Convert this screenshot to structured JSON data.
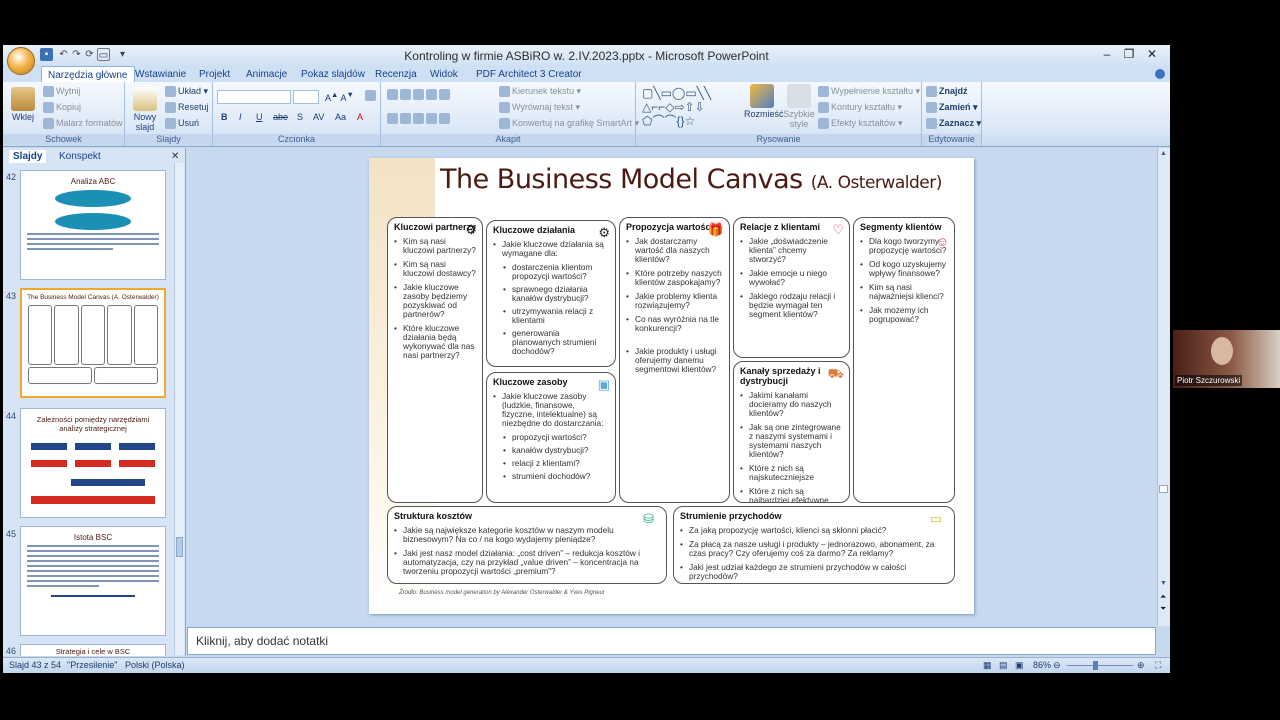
{
  "window": {
    "title": "Kontroling w firmie ASBiRO w. 2.IV.2023.pptx - Microsoft PowerPoint"
  },
  "ribbon_tabs": [
    "Narzędzia główne",
    "Wstawianie",
    "Projekt",
    "Animacje",
    "Pokaz slajdów",
    "Recenzja",
    "Widok",
    "PDF Architect 3 Creator"
  ],
  "ribbon": {
    "schowek": {
      "paste": "Wklej",
      "cut": "Wytnij",
      "copy": "Kopiuj",
      "painter": "Malarz formatów",
      "label": "Schowek"
    },
    "slajdy": {
      "new": "Nowy slajd",
      "layout": "Układ",
      "reset": "Resetuj",
      "delete": "Usuń",
      "label": "Slajdy"
    },
    "czcionka": {
      "label": "Czcionka"
    },
    "akapit": {
      "dir": "Kierunek tekstu",
      "align": "Wyrównaj tekst",
      "smartart": "Konwertuj na grafikę SmartArt",
      "label": "Akapit"
    },
    "rysowanie": {
      "arrange": "Rozmieść",
      "styles": "Szybkie style",
      "fill": "Wypełnienie kształtu",
      "outline": "Kontury kształtu",
      "effects": "Efekty kształtów",
      "label": "Rysowanie"
    },
    "edytowanie": {
      "find": "Znajdź",
      "replace": "Zamień",
      "select": "Zaznacz",
      "label": "Edytowanie"
    }
  },
  "pane": {
    "tabs": [
      "Slajdy",
      "Konspekt"
    ],
    "thumbs": [
      {
        "num": "42",
        "title": "Analiza ABC"
      },
      {
        "num": "43",
        "title": "The Business Model Canvas (A. Osterwalder)"
      },
      {
        "num": "44",
        "title": "Zależności pomiędzy narzędziami analizy strategicznej"
      },
      {
        "num": "45",
        "title": "Istota BSC"
      },
      {
        "num": "46",
        "title": "Strategia i cele w BSC"
      }
    ]
  },
  "slide": {
    "title": "The Business Model Canvas",
    "title_suffix": "(A. Osterwalder)",
    "boxes": {
      "partnerzy": {
        "h": "Kluczowi partnerzy",
        "q": [
          "Kim są nasi kluczowi partnerzy?",
          "Kim są nasi kluczowi dostawcy?",
          "Jakie kluczowe zasoby będziemy pozyskiwać od partnerów?",
          "Które kluczowe działania będą wykonywać dla nas nasi partnerzy?"
        ]
      },
      "dzialania": {
        "h": "Kluczowe działania",
        "q": "Jakie kluczowe działania są wymagane dla:",
        "s": [
          "dostarczenia klientom propozycji wartości?",
          "sprawnego działania kanałów dystrybucji?",
          "utrzymywania relacji z klientami",
          "generowania planowanych strumieni dochodów?"
        ]
      },
      "zasoby": {
        "h": "Kluczowe zasoby",
        "q": "Jakie kluczowe zasoby (ludzkie, finansowe, fizyczne, intelektualne) są niezbędne do dostarczania:",
        "s": [
          "propozycji wartości?",
          "kanałów dystrybucji?",
          "relacji z klientami?",
          "strumieni dochodów?"
        ]
      },
      "propozycja": {
        "h": "Propozycja wartości",
        "q": [
          "Jak dostarczamy wartość dla naszych klientów?",
          "Które potrzeby naszych klientów zaspokajamy?",
          "Jakie problemy klienta rozwiązujemy?",
          "Co nas wyróżnia na tle konkurencji?",
          "Jakie produkty i usługi oferujemy danemu segmentowi klientów?"
        ]
      },
      "relacje": {
        "h": "Relacje z klientami",
        "q": [
          "Jakie „doświadczenie klienta” chcemy stworzyć?",
          "Jakie emocje u niego wywołać?",
          "Jakiego rodzaju relacji i będzie wymagał ten segment klientów?"
        ]
      },
      "kanaly": {
        "h": "Kanały sprzedaży i dystrybucji",
        "q": [
          "Jakimi kanałami docieramy do naszych klientów?",
          "Jak są one zintegrowane z naszymi systemami i systemami naszych klientów?",
          "Które z nich są najskuteczniejsze",
          "Które z nich są najbardziej efektywne kosztowo?"
        ]
      },
      "segmenty": {
        "h": "Segmenty klientów",
        "q": [
          "Dla kogo tworzymy propozycję wartości?",
          "Od kogo uzyskujemy wpływy finansowe?",
          "Kim są nasi najważniejsi klienci?",
          "Jak możemy ich pogrupować?"
        ]
      },
      "koszty": {
        "h": "Struktura kosztów",
        "q": [
          "Jakie są największe kategorie kosztów w naszym modelu biznesowym? Na co / na kogo wydajemy pieniądze?",
          "Jaki jest nasz model działania: „cost driven” – redukcja kosztów i automatyzacja, czy na przykład „value driven” – koncentracja na tworzeniu propozycji wartości „premium”?"
        ]
      },
      "przychody": {
        "h": "Strumienie przychodów",
        "q": [
          "Za jaką propozycję wartości, klienci są skłonni płacić?",
          "Za płacą za nasze usługi i produkty – jednorazowo, abonament, za czas pracy? Czy oferujemy coś za darmo? Za reklamy?",
          "Jaki jest udział każdego ze strumieni przychodów w całości przychodów?"
        ]
      }
    },
    "source": "Źródło: Business model generation by Alexander Osterwalder & Yves Pigneur"
  },
  "notes_placeholder": "Kliknij, aby dodać notatki",
  "status": {
    "slide": "Slajd 43 z 54",
    "theme": "\"Przesilenie\"",
    "lang": "Polski (Polska)",
    "zoom": "86%"
  },
  "webcam": {
    "name": "Piotr Szczurowski"
  }
}
